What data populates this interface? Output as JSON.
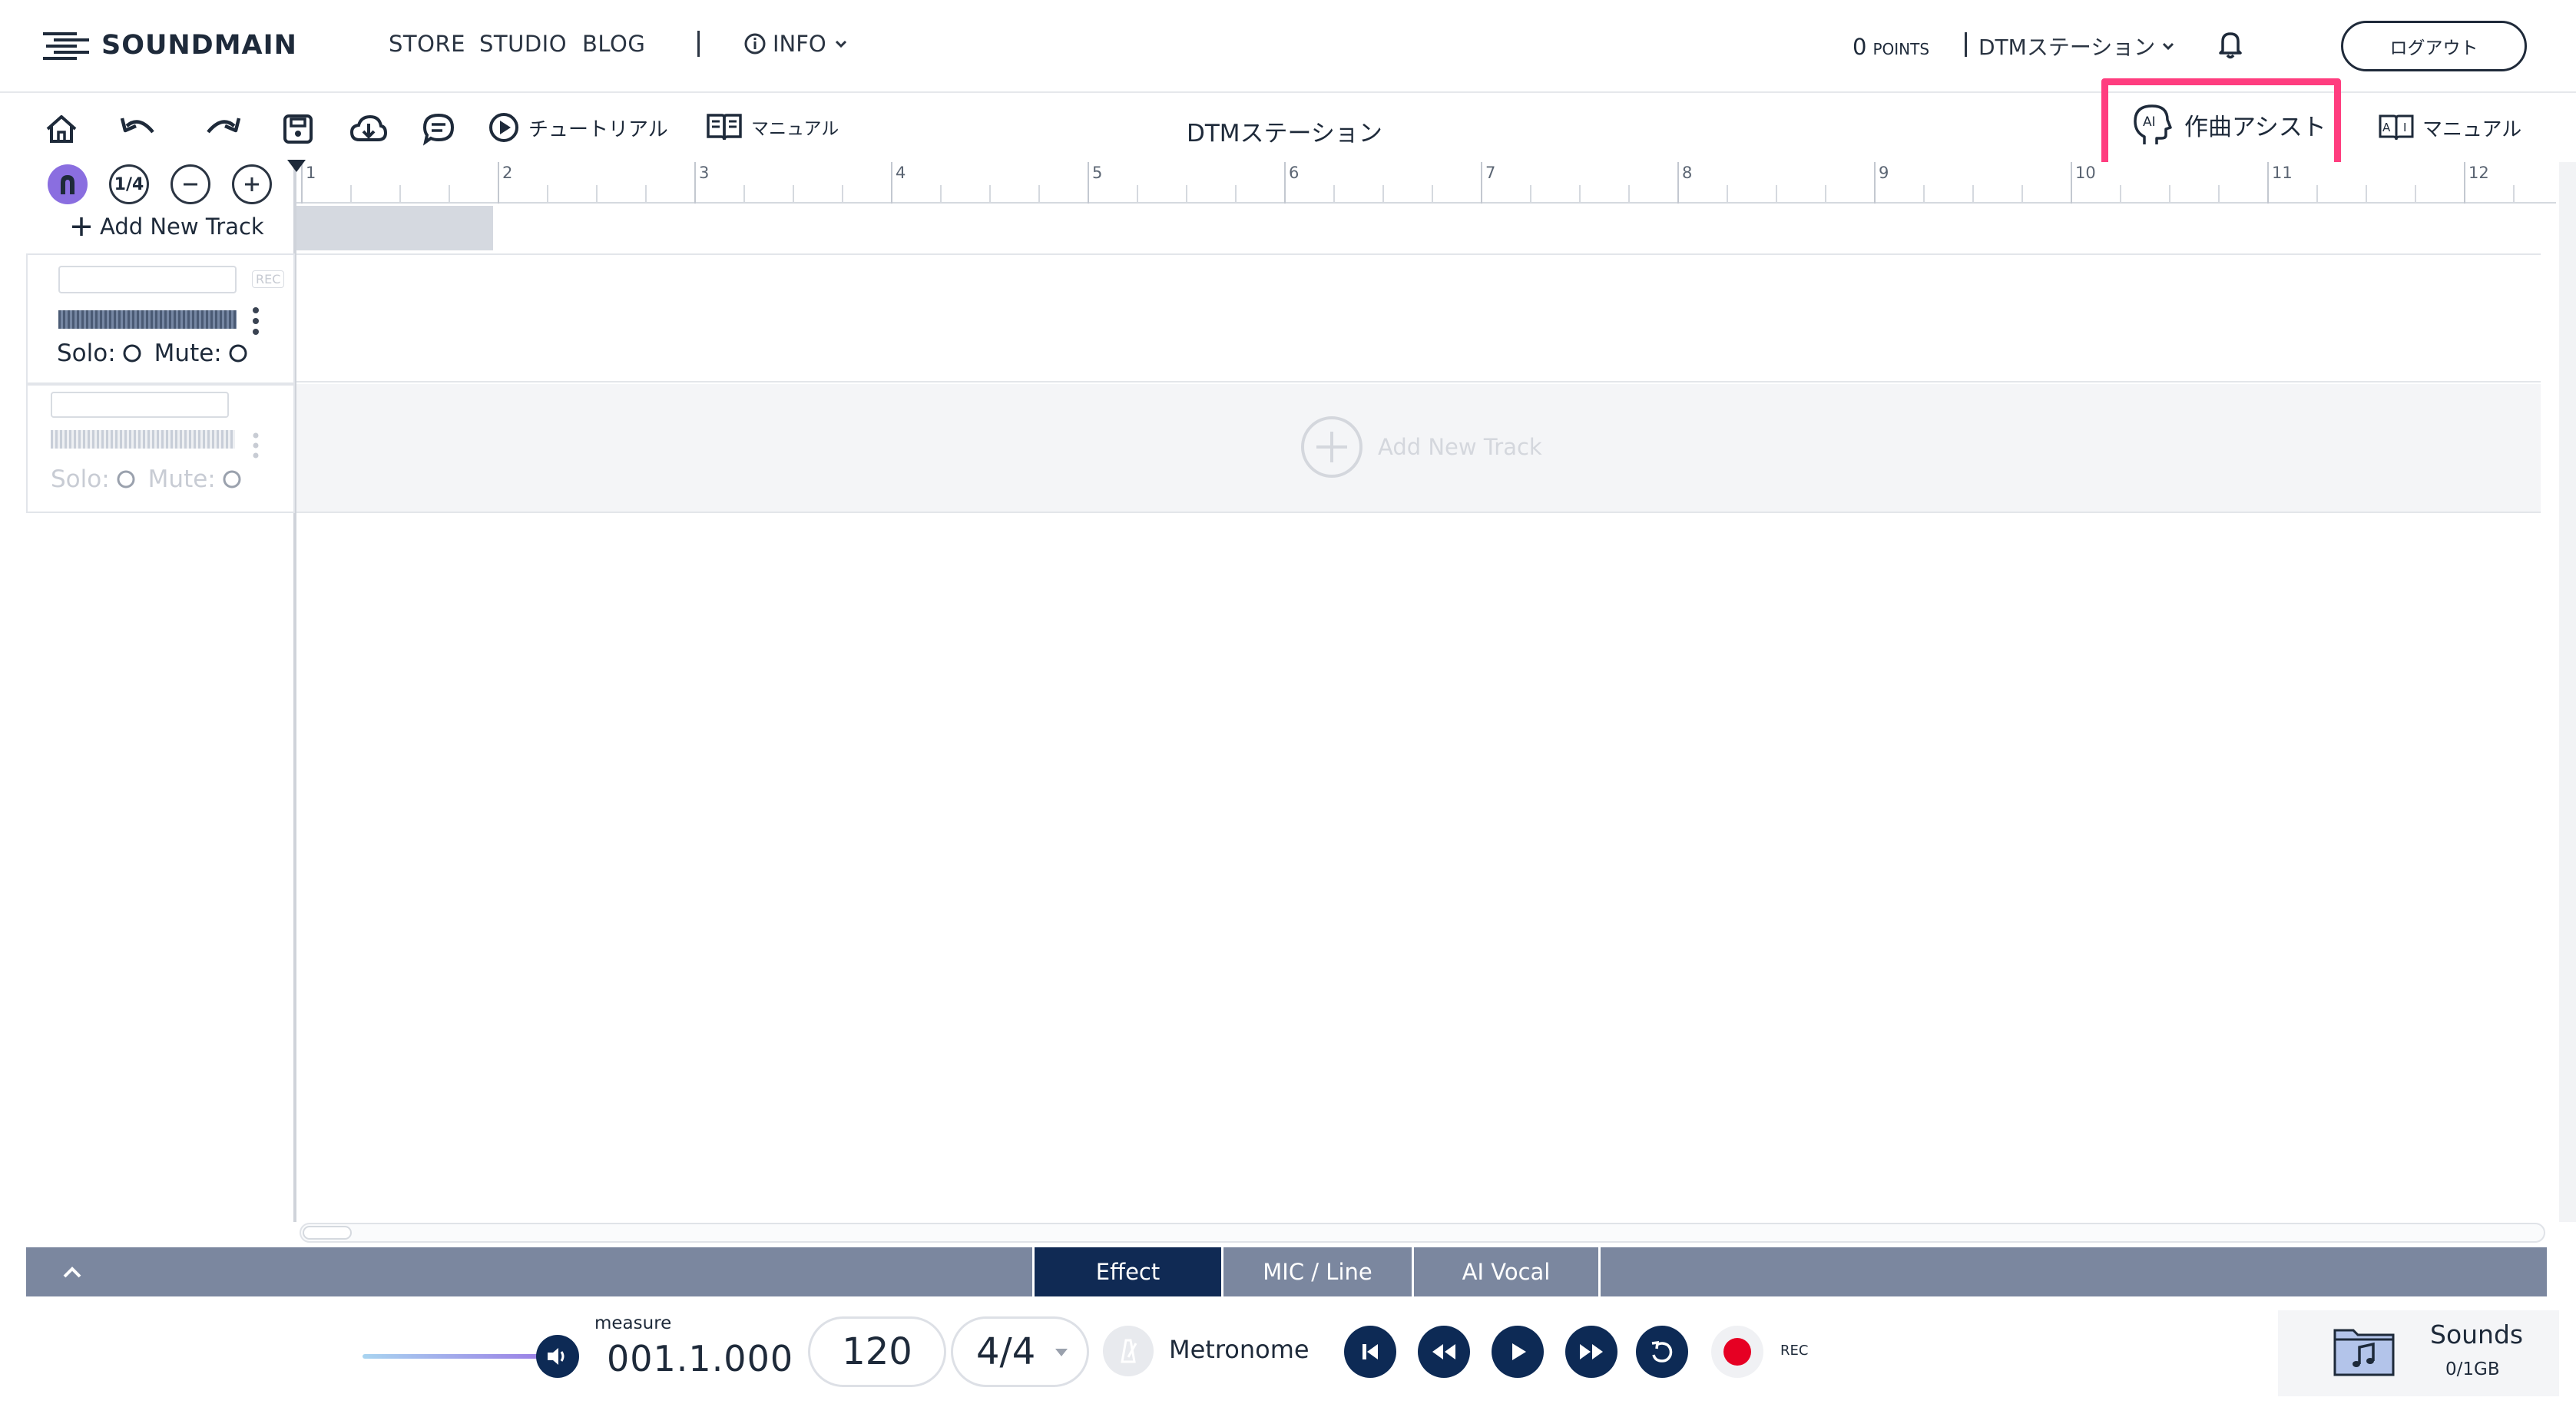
{
  "app": {
    "brand": "SOUNDMAIN",
    "nav": [
      "STORE",
      "STUDIO",
      "BLOG"
    ],
    "info_label": "INFO",
    "points_value": "0",
    "points_unit": "POINTS",
    "station_menu": "DTMステーション",
    "logout_label": "ログアウト"
  },
  "toolbar": {
    "tutorial_label": "チュートリアル",
    "manual_label": "マニュアル",
    "title": "DTMステーション",
    "ai_assist_label": "作曲アシスト",
    "ai_manual_label": "マニュアル",
    "ai_mark": "AI",
    "highlight_color": "#ff3d7f"
  },
  "tracks": {
    "quantize_label": "1/4",
    "add_track_label": "Add New Track",
    "rec_label": "REC",
    "solo_label": "Solo:",
    "mute_label": "Mute:",
    "lane_add_label": "Add New Track"
  },
  "ruler": {
    "measures": [
      "1",
      "2",
      "3",
      "4",
      "5",
      "6",
      "7",
      "8",
      "9",
      "10",
      "11",
      "12"
    ]
  },
  "panel_tabs": [
    {
      "label": "Effect",
      "active": true
    },
    {
      "label": "MIC / Line",
      "active": false
    },
    {
      "label": "AI Vocal",
      "active": false
    }
  ],
  "transport": {
    "measure_label": "measure",
    "position": "001.1.000",
    "tempo": "120",
    "time_signature": "4/4",
    "metronome_label": "Metronome",
    "rec_label": "REC",
    "sounds_label": "Sounds",
    "storage": "0/1GB"
  },
  "colors": {
    "navy": "#0d2a55",
    "tab_bar": "#7b879f",
    "rec_red": "#e60023",
    "snap_purple": "#8a6ee0"
  }
}
